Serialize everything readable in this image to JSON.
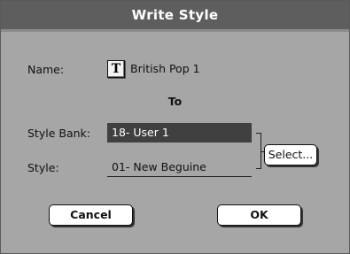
{
  "dialog": {
    "title": "Write Style"
  },
  "name_row": {
    "label": "Name:",
    "icon": "text-edit-icon",
    "icon_glyph": "T",
    "value": "British Pop 1"
  },
  "to_label": "To",
  "style_bank": {
    "label": "Style Bank:",
    "value": "18- User 1"
  },
  "style": {
    "label": "Style:",
    "value": "01- New Beguine"
  },
  "buttons": {
    "select": "Select...",
    "cancel": "Cancel",
    "ok": "OK"
  }
}
